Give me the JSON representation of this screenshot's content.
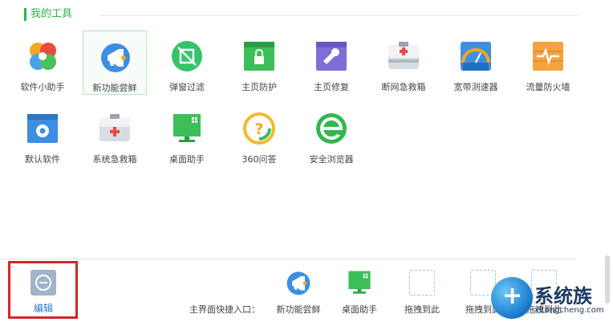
{
  "section": {
    "title": "我的工具"
  },
  "tools": [
    {
      "label": "软件小助手",
      "icon": "software-helper-icon"
    },
    {
      "label": "新功能尝鲜",
      "icon": "megaphone-icon",
      "selected": true
    },
    {
      "label": "弹窗过滤",
      "icon": "popup-filter-icon"
    },
    {
      "label": "主页防护",
      "icon": "homepage-lock-icon"
    },
    {
      "label": "主页修复",
      "icon": "wrench-icon"
    },
    {
      "label": "断网急救箱",
      "icon": "network-firstaid-icon"
    },
    {
      "label": "宽带测速器",
      "icon": "speed-gauge-icon"
    },
    {
      "label": "流量防火墙",
      "icon": "firewall-icon"
    },
    {
      "label": "默认软件",
      "icon": "default-software-icon"
    },
    {
      "label": "系统急救箱",
      "icon": "system-firstaid-icon"
    },
    {
      "label": "桌面助手",
      "icon": "desktop-monitor-icon"
    },
    {
      "label": "360问答",
      "icon": "question-icon"
    },
    {
      "label": "安全浏览器",
      "icon": "browser-icon"
    }
  ],
  "footer": {
    "edit_label": "编辑",
    "quick_label": "主界面快捷入口：",
    "quick_items": [
      {
        "label": "新功能尝鲜",
        "icon": "megaphone-icon"
      },
      {
        "label": "桌面助手",
        "icon": "desktop-monitor-icon"
      },
      {
        "label": "拖拽到此",
        "icon": "drop-slot"
      },
      {
        "label": "拖拽到此",
        "icon": "drop-slot"
      },
      {
        "label": "拖拽到此",
        "icon": "drop-slot"
      }
    ]
  },
  "watermark": {
    "text": "系统族",
    "url": "xitongcheng.com"
  },
  "colors": {
    "accent": "#2cb44a",
    "edit_link": "#2a79c4",
    "highlight_border": "#d8232a"
  }
}
